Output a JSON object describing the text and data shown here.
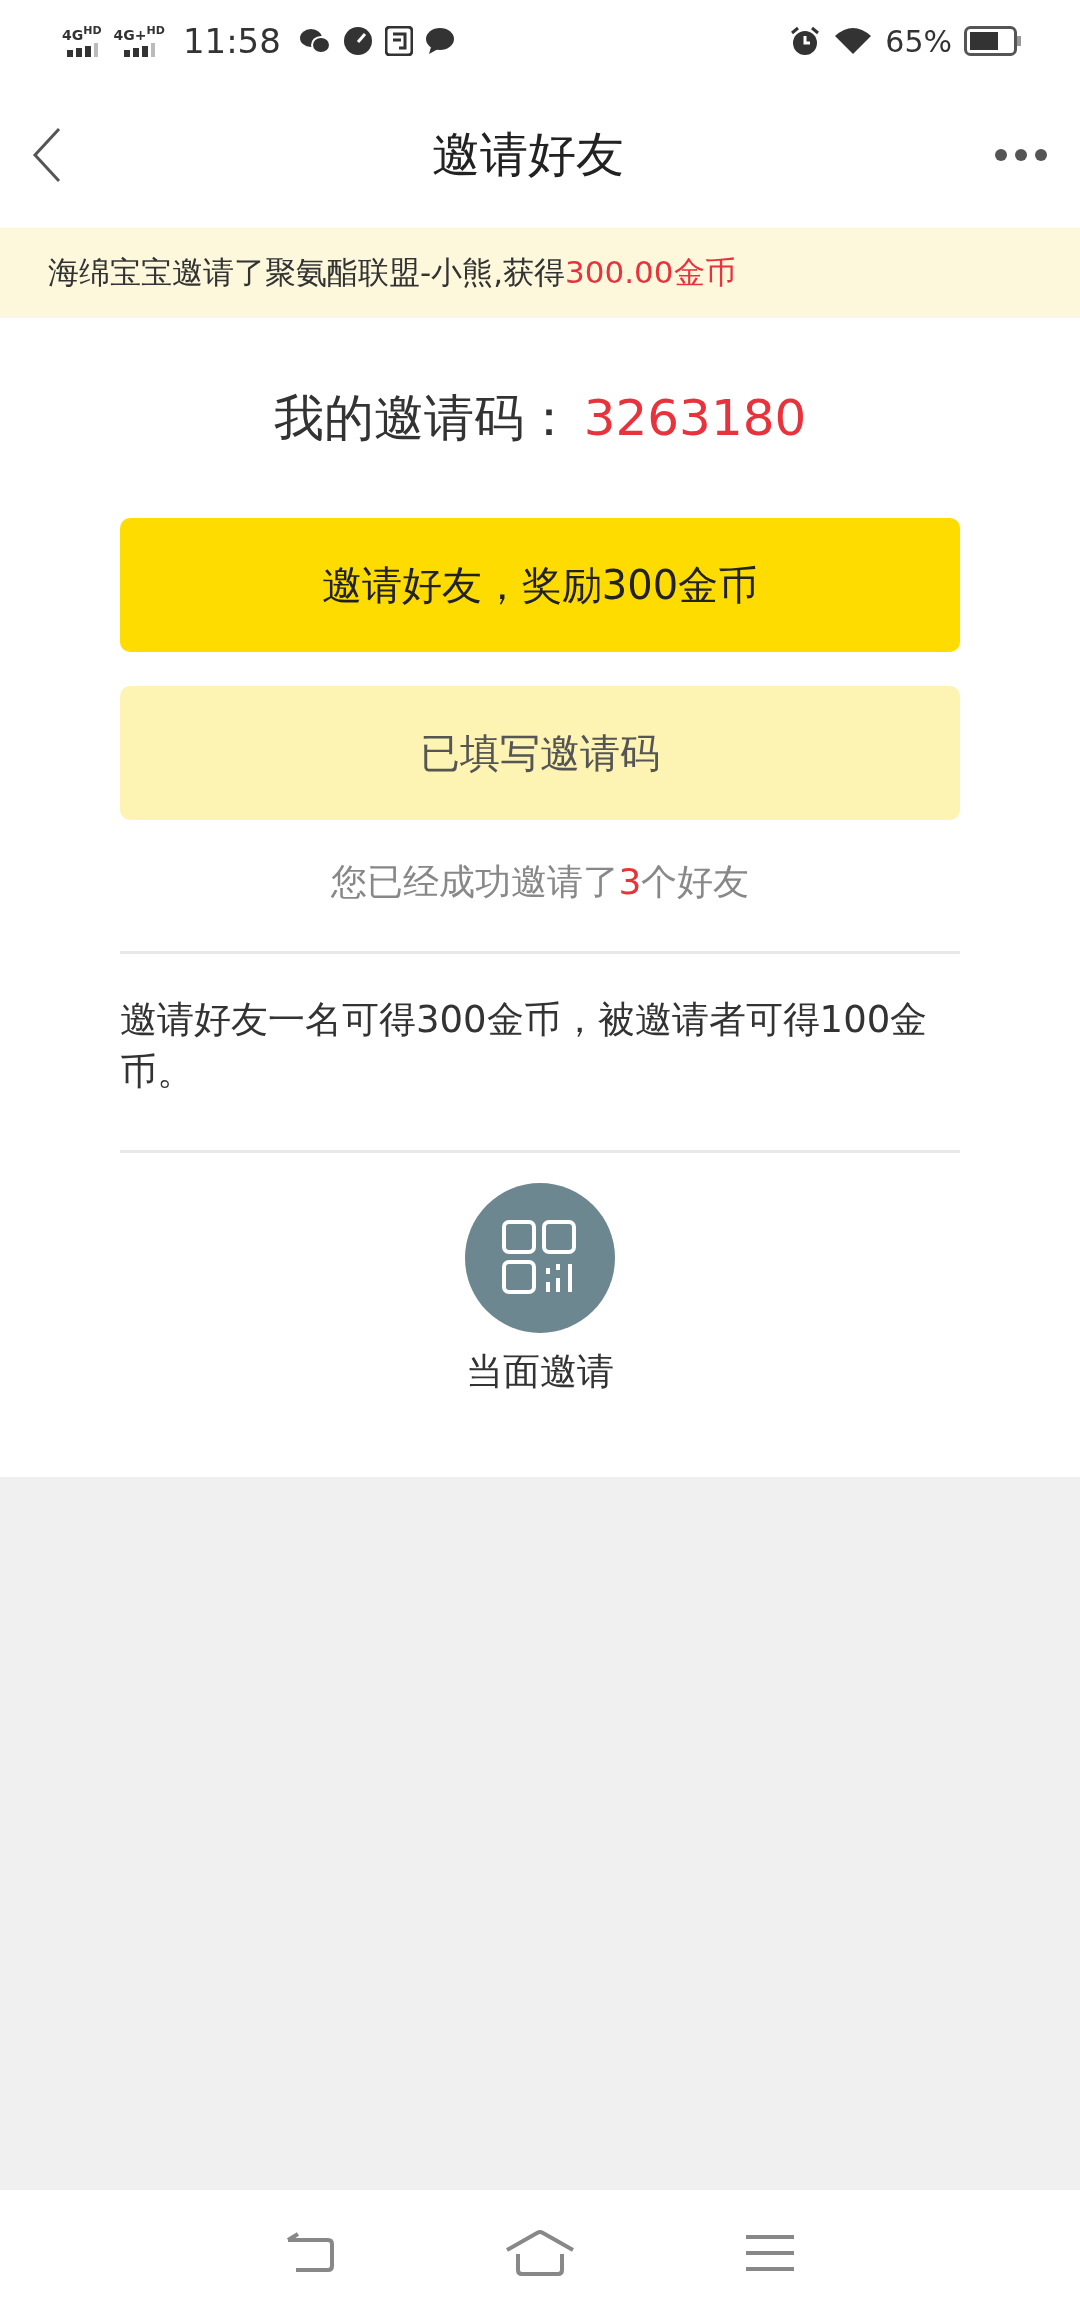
{
  "status_bar": {
    "signals": [
      "4G$^{HD}$",
      "4G+$^{HD}$"
    ],
    "time": "11:58",
    "battery": "65%"
  },
  "header": {
    "title": "邀请好友"
  },
  "banner": {
    "text": "海绵宝宝邀请了聚氨酯联盟-小熊,获得",
    "highlight": "300.00金币"
  },
  "invite_code": {
    "label": "我的邀请码：",
    "code": "3263180"
  },
  "buttons": [
    {
      "label": "邀请好友，奖励300金币",
      "kind": "primary"
    },
    {
      "label": "已填写邀请码",
      "kind": "done"
    }
  ],
  "invited_summary": {
    "prefix": "您已经成功邀请了",
    "count": "3",
    "suffix": "个好友"
  },
  "rules": "邀请好友一名可得300金币，被邀请者可得100金币。",
  "share_option": {
    "label": "当面邀请"
  }
}
